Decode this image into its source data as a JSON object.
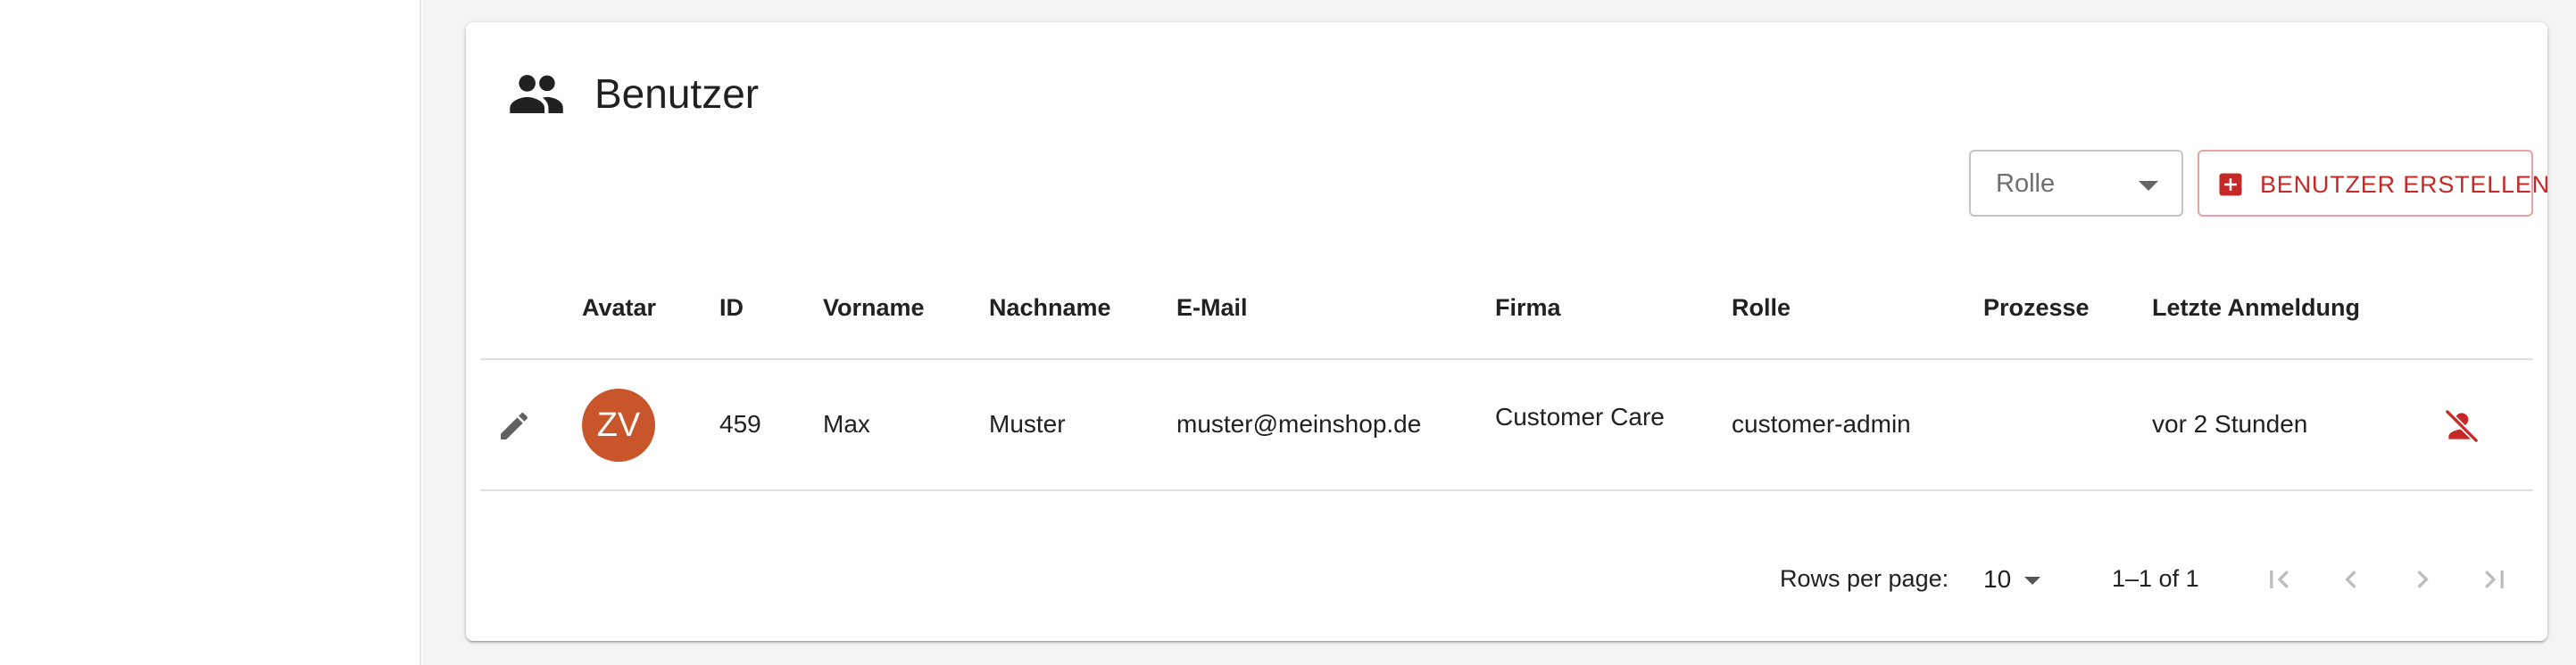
{
  "page": {
    "title": "Benutzer"
  },
  "filters": {
    "role_select": {
      "label": "Rolle",
      "value": ""
    }
  },
  "actions": {
    "create_label": "BENUTZER ERSTELLEN"
  },
  "table": {
    "columns": [
      "Avatar",
      "ID",
      "Vorname",
      "Nachname",
      "E-Mail",
      "Firma",
      "Rolle",
      "Prozesse",
      "Letzte Anmeldung"
    ],
    "rows": [
      {
        "avatar_initials": "ZV",
        "avatar_color": "#c9552b",
        "id": "459",
        "firstname": "Max",
        "lastname": "Muster",
        "email": "muster@meinshop.de",
        "company": "Customer Care",
        "role": "customer-admin",
        "processes": "",
        "last_login": "vor 2 Stunden"
      }
    ]
  },
  "pagination": {
    "rows_per_page_label": "Rows per page:",
    "rows_per_page_value": "10",
    "range_text": "1–1 of 1"
  },
  "icons": {
    "title": "people-icon",
    "create": "add-box-icon",
    "edit": "pencil-icon",
    "deactivate": "person-off-icon",
    "first_page": "first-page-icon",
    "prev_page": "chevron-left-icon",
    "next_page": "chevron-right-icon",
    "last_page": "last-page-icon"
  },
  "colors": {
    "accent": "#c62828",
    "accent_border": "#e8a2a6",
    "background": "#f4f4f4",
    "divider": "#e0e0e0",
    "disabled_icon": "#bdbdbd"
  }
}
